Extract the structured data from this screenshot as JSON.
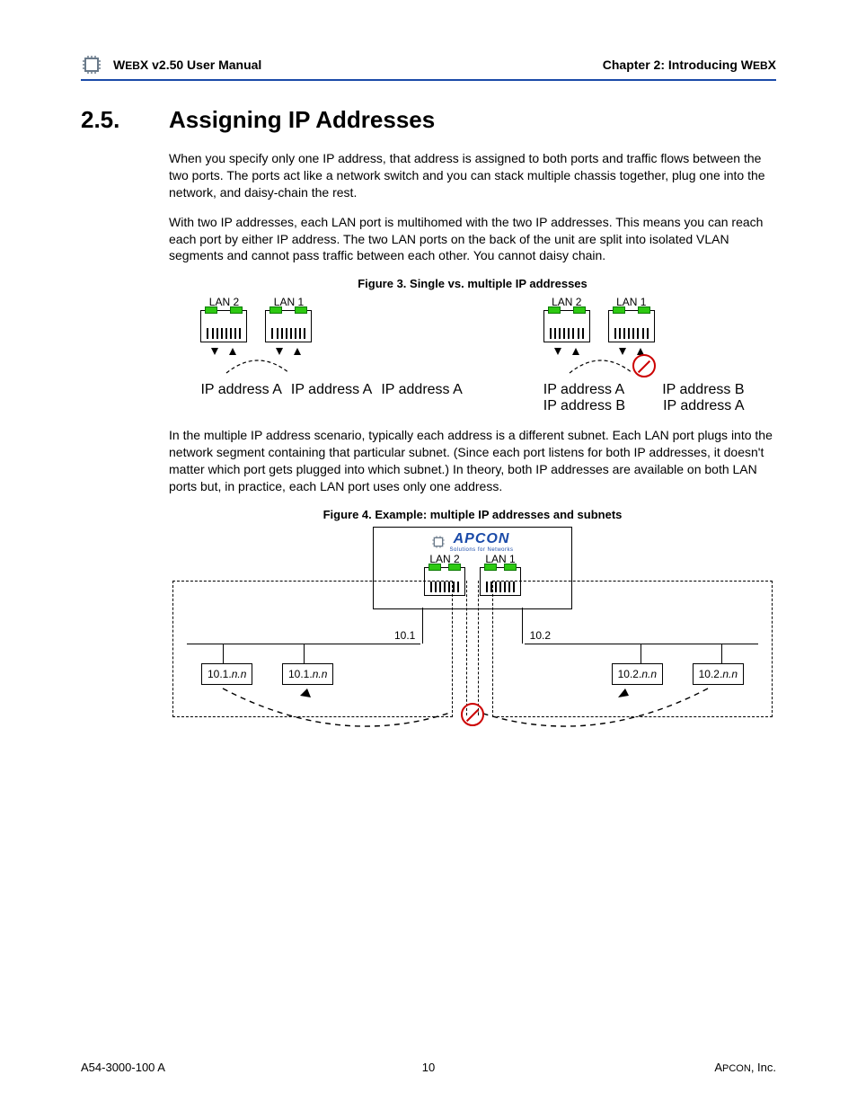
{
  "header": {
    "left_a": "W",
    "left_b": "EB",
    "left_c": "X v2.50 User Manual",
    "right_a": "Chapter 2: Introducing W",
    "right_b": "EB",
    "right_c": "X"
  },
  "section": {
    "number": "2.5.",
    "title": "Assigning IP Addresses"
  },
  "p1": "When you specify only one IP address, that address is assigned to both ports and traffic flows between the two ports. The ports act like a network switch and you can stack multiple chassis together, plug one into the network, and daisy-chain the rest.",
  "p2": "With two IP addresses, each LAN port is multihomed with the two IP addresses. This means you can reach each port by either IP address. The two LAN ports on the back of the unit are split into isolated VLAN segments and cannot pass traffic between each other. You cannot daisy chain.",
  "fig3": {
    "caption": "Figure 3. Single vs. multiple IP addresses",
    "lan2": "LAN 2",
    "lan1": "LAN 1",
    "addrA": "IP address A",
    "addrB": "IP address B"
  },
  "p3": "In the multiple IP address scenario, typically each address is a different subnet. Each LAN port plugs into the network segment containing that particular subnet. (Since each port listens for both IP addresses, it doesn't matter which port gets plugged into which subnet.)  In theory, both IP addresses are available on both LAN ports but, in practice, each LAN port uses only one address.",
  "fig4": {
    "caption": "Figure 4. Example: multiple IP addresses and subnets",
    "lan2": "LAN 2",
    "lan1": "LAN 1",
    "logo": "APCON",
    "tag": "Solutions for Networks",
    "subnet1": "10.1",
    "subnet2": "10.2",
    "host1a": "10.1.",
    "host1b": "10.1.",
    "host2a": "10.2.",
    "host2b": "10.2.",
    "nn": "n.n"
  },
  "footer": {
    "left": "A54-3000-100 A",
    "center": "10",
    "right_a": "A",
    "right_b": "PCON",
    "right_c": ", Inc."
  }
}
